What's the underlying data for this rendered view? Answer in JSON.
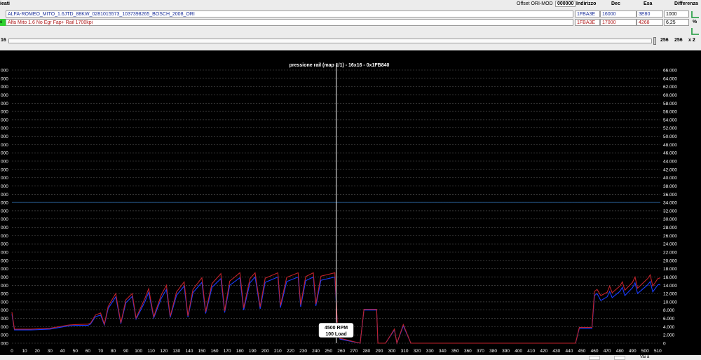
{
  "header": {
    "left_label": "ieati",
    "offset_label": "Offset ORI-MOD",
    "offset_value": "000000",
    "col_address": "Indirizzo",
    "col_dec": "Dec",
    "col_hex": "Esa",
    "col_diff": "Differenza"
  },
  "files": [
    {
      "marker": "",
      "name": "ALFA-ROMEO_MITO_1.6JTD_88KW_0281015573_1037398265_BOSCH_2008_ORI",
      "address": "1FBA3E",
      "dec": "16000",
      "hex": "3E80",
      "diff": "1000",
      "button": ""
    },
    {
      "marker": "o",
      "name": "Alfa Mito 1.6 No Egr Fap+ Rail 1700kpi",
      "address": "1FBA3E",
      "dec": "17000",
      "hex": "4268",
      "diff": "6,25",
      "button": "%"
    }
  ],
  "toolbar": {
    "left_value": "16",
    "val_a": "256",
    "val_b": "256",
    "mult": "x 2"
  },
  "chart_data": {
    "type": "line",
    "title": "pressione rail (map 1/1) - 16x16 - 0x1FB840",
    "xlim": [
      0,
      512
    ],
    "xticks": [
      0,
      10,
      20,
      30,
      40,
      50,
      60,
      70,
      80,
      90,
      100,
      110,
      120,
      130,
      140,
      150,
      160,
      170,
      180,
      190,
      200,
      210,
      220,
      230,
      240,
      250,
      260,
      270,
      280,
      290,
      300,
      310,
      320,
      330,
      340,
      350,
      360,
      370,
      380,
      390,
      400,
      410,
      420,
      430,
      440,
      450,
      460,
      470,
      480,
      490,
      500,
      510
    ],
    "ylim": [
      0,
      66000
    ],
    "yticks_right": [
      "0",
      "2.000",
      "4.000",
      "6.000",
      "8.000",
      "10.000",
      "12.000",
      "14.000",
      "16.000",
      "18.000",
      "20.000",
      "22.000",
      "24.000",
      "26.000",
      "28.000",
      "30.000",
      "32.000",
      "34.000",
      "36.000",
      "38.000",
      "40.000",
      "42.000",
      "44.000",
      "46.000",
      "48.000",
      "50.000",
      "52.000",
      "54.000",
      "56.000",
      "58.000",
      "60.000",
      "62.000",
      "64.000",
      "66.000"
    ],
    "yticks_left": [
      "000",
      "000",
      "000",
      "000",
      "000",
      "000",
      "000",
      "000",
      "000",
      "000",
      "000",
      "000",
      "000",
      "000",
      "000",
      "000",
      "000",
      "000",
      "000",
      "000",
      "000",
      "000",
      "000",
      "000",
      "000",
      "000",
      "000",
      "000",
      "000",
      "000",
      "000",
      "000",
      "000",
      "000"
    ],
    "grid": true,
    "cursor": {
      "x": 256,
      "rpm_label": "4500 RPM",
      "load_label": "100 Load"
    },
    "reference_line": {
      "y": 34000
    },
    "series": [
      {
        "color": "#1a3cff",
        "points": [
          [
            0,
            7000
          ],
          [
            2,
            3200
          ],
          [
            15,
            3200
          ],
          [
            30,
            3400
          ],
          [
            45,
            4200
          ],
          [
            50,
            4300
          ],
          [
            60,
            4300
          ],
          [
            62,
            4600
          ],
          [
            66,
            6400
          ],
          [
            70,
            6800
          ],
          [
            73,
            4400
          ],
          [
            76,
            8400
          ],
          [
            82,
            11200
          ],
          [
            86,
            4700
          ],
          [
            90,
            9800
          ],
          [
            95,
            11300
          ],
          [
            98,
            5800
          ],
          [
            105,
            10000
          ],
          [
            108,
            12300
          ],
          [
            112,
            6100
          ],
          [
            118,
            10900
          ],
          [
            122,
            13000
          ],
          [
            125,
            6200
          ],
          [
            130,
            11600
          ],
          [
            136,
            13800
          ],
          [
            139,
            6300
          ],
          [
            143,
            12200
          ],
          [
            150,
            14700
          ],
          [
            153,
            7200
          ],
          [
            158,
            13500
          ],
          [
            165,
            15600
          ],
          [
            168,
            7400
          ],
          [
            172,
            14000
          ],
          [
            180,
            15800
          ],
          [
            183,
            8000
          ],
          [
            188,
            14600
          ],
          [
            192,
            16000
          ],
          [
            196,
            8300
          ],
          [
            200,
            14700
          ],
          [
            210,
            16000
          ],
          [
            212,
            8600
          ],
          [
            217,
            14900
          ],
          [
            226,
            16000
          ],
          [
            228,
            8800
          ],
          [
            232,
            15100
          ],
          [
            238,
            16000
          ],
          [
            240,
            9000
          ],
          [
            244,
            15200
          ],
          [
            255,
            16000
          ],
          [
            257,
            4200
          ],
          [
            259,
            1000
          ],
          [
            275,
            0
          ],
          [
            278,
            8000
          ],
          [
            288,
            8000
          ],
          [
            289,
            0
          ],
          [
            295,
            0
          ],
          [
            302,
            3200
          ],
          [
            304,
            0
          ],
          [
            309,
            4200
          ],
          [
            315,
            0
          ],
          [
            445,
            0
          ],
          [
            448,
            3600
          ],
          [
            458,
            3600
          ],
          [
            460,
            11500
          ],
          [
            462,
            12000
          ],
          [
            465,
            10300
          ],
          [
            470,
            11200
          ],
          [
            472,
            12500
          ],
          [
            474,
            11000
          ],
          [
            480,
            12500
          ],
          [
            482,
            13500
          ],
          [
            484,
            11500
          ],
          [
            490,
            13400
          ],
          [
            492,
            14600
          ],
          [
            494,
            12000
          ],
          [
            502,
            14100
          ],
          [
            504,
            14900
          ],
          [
            506,
            12400
          ],
          [
            510,
            14100
          ],
          [
            512,
            14200
          ]
        ]
      },
      {
        "color": "#c0222a",
        "points": [
          [
            0,
            7500
          ],
          [
            2,
            3400
          ],
          [
            15,
            3400
          ],
          [
            30,
            3600
          ],
          [
            45,
            4400
          ],
          [
            50,
            4500
          ],
          [
            60,
            4600
          ],
          [
            62,
            4800
          ],
          [
            66,
            6800
          ],
          [
            70,
            7300
          ],
          [
            73,
            4600
          ],
          [
            76,
            8900
          ],
          [
            82,
            12000
          ],
          [
            86,
            4900
          ],
          [
            90,
            10500
          ],
          [
            95,
            12000
          ],
          [
            98,
            6100
          ],
          [
            105,
            10800
          ],
          [
            108,
            13200
          ],
          [
            112,
            6400
          ],
          [
            118,
            11700
          ],
          [
            122,
            14000
          ],
          [
            125,
            6500
          ],
          [
            130,
            12400
          ],
          [
            136,
            14800
          ],
          [
            139,
            6600
          ],
          [
            143,
            13000
          ],
          [
            150,
            15800
          ],
          [
            153,
            7600
          ],
          [
            158,
            14400
          ],
          [
            165,
            16800
          ],
          [
            168,
            7800
          ],
          [
            172,
            15000
          ],
          [
            180,
            17000
          ],
          [
            183,
            8500
          ],
          [
            188,
            15600
          ],
          [
            192,
            17000
          ],
          [
            196,
            8800
          ],
          [
            200,
            15700
          ],
          [
            210,
            17000
          ],
          [
            212,
            9100
          ],
          [
            217,
            15900
          ],
          [
            226,
            17000
          ],
          [
            228,
            9300
          ],
          [
            232,
            16100
          ],
          [
            238,
            17000
          ],
          [
            240,
            9500
          ],
          [
            244,
            16200
          ],
          [
            255,
            17000
          ],
          [
            257,
            4500
          ],
          [
            259,
            1200
          ],
          [
            275,
            0
          ],
          [
            278,
            8200
          ],
          [
            288,
            8200
          ],
          [
            289,
            0
          ],
          [
            295,
            0
          ],
          [
            302,
            3400
          ],
          [
            304,
            0
          ],
          [
            309,
            4500
          ],
          [
            315,
            0
          ],
          [
            445,
            0
          ],
          [
            448,
            3800
          ],
          [
            458,
            3800
          ],
          [
            460,
            12500
          ],
          [
            462,
            13000
          ],
          [
            465,
            11500
          ],
          [
            470,
            12300
          ],
          [
            472,
            13800
          ],
          [
            474,
            12200
          ],
          [
            480,
            13800
          ],
          [
            482,
            14800
          ],
          [
            484,
            12800
          ],
          [
            490,
            14700
          ],
          [
            492,
            16000
          ],
          [
            494,
            13300
          ],
          [
            502,
            15600
          ],
          [
            504,
            16500
          ],
          [
            506,
            13800
          ],
          [
            510,
            15600
          ],
          [
            512,
            15800
          ]
        ]
      }
    ]
  },
  "footer": {
    "label": "Vai a"
  }
}
